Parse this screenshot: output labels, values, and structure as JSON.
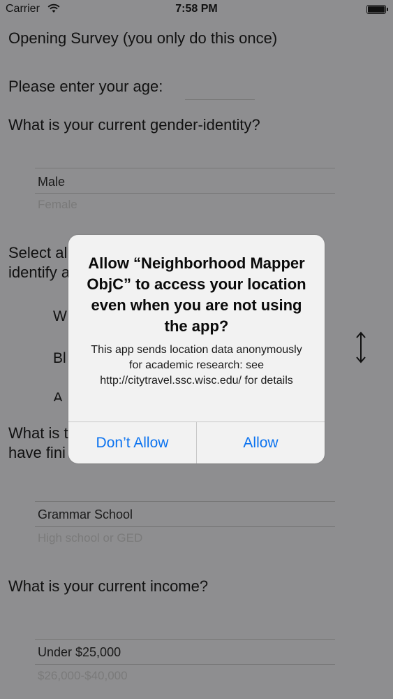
{
  "status_bar": {
    "carrier": "Carrier",
    "time": "7:58 PM",
    "wifi_icon": "wifi-icon",
    "battery_icon": "battery-icon"
  },
  "survey": {
    "title": "Opening Survey (you only do this once)",
    "age_label": "Please enter your age:",
    "gender_question": "What is your current gender-identity?",
    "gender_options": [
      "Male",
      "Female"
    ],
    "race_question_line1": "Select al",
    "race_question_line2": "identify a",
    "race_partial_options": [
      "W",
      "Bl",
      "A"
    ],
    "education_question_line1": "What is t",
    "education_question_line2": "have fini",
    "education_options": [
      "Grammar School",
      "High school or GED"
    ],
    "income_question": "What is your current income?",
    "income_options": [
      "Under $25,000",
      "$26,000-$40,000"
    ]
  },
  "alert": {
    "title": "Allow “Neighborhood Mapper ObjC” to access your location even when you are not using the app?",
    "message": "This app sends location data anonymously for academic research: see http://citytravel.ssc.wisc.edu/ for details",
    "buttons": {
      "dont_allow": "Don’t Allow",
      "allow": "Allow"
    },
    "accent_color": "#0a72f0"
  },
  "colors": {
    "dimmed_background": "#8e8e90",
    "alert_background": "#f2f2f2"
  }
}
